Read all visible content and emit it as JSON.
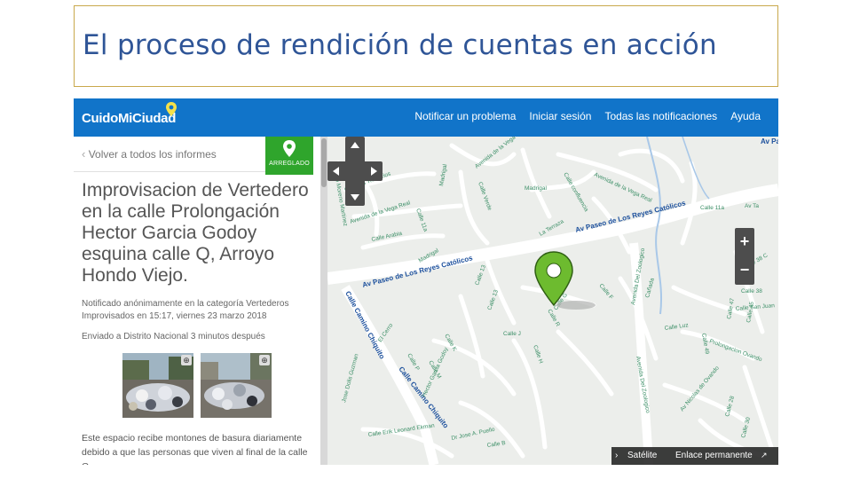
{
  "slide": {
    "title": "El proceso de rendición de cuentas en acción"
  },
  "app": {
    "logo": "CuidoMiCiudad",
    "nav": [
      "Notificar un problema",
      "Iniciar sesión",
      "Todas las notificaciones",
      "Ayuda"
    ]
  },
  "sidebar": {
    "back_link": "Volver a todos los informes",
    "status_badge": "ARREGLADO",
    "report_title": "Improvisacion de Vertedero en la calle Prolongación Hector Garcia Godoy esquina calle Q, Arroyo Hondo Viejo.",
    "meta_line1": "Notificado anónimamente en la categoría Vertederos Improvisados en 15:17, viernes 23 marzo 2018",
    "meta_line2": "Enviado a Distrito Nacional 3 minutos después",
    "description": "Este espacio recibe montones de basura diariamente debido a que las personas que viven al final de la calle Q"
  },
  "map": {
    "main_roads": [
      "Av Paseo de Los Reyes Católicos",
      "Av Paseo de Los Reyes Católicos",
      "Calle Camino Chiquito",
      "Calle Camino Chiquito"
    ],
    "streets": [
      "Calle los Trinitarios",
      "Avenida de la Vega Real",
      "Avenida de la Vega Real",
      "Avenida de la Vega Real",
      "Madrigal",
      "Madrigal",
      "Calle Arabia",
      "Calle Verde",
      "Calle confluencia",
      "La Terraza",
      "Madrigal",
      "Calle 11a",
      "Calle 13",
      "Calle J",
      "Calle K",
      "Calle P",
      "Calle M",
      "Hector Garcia Godoy",
      "Calle Erik Leonard Ekman",
      "Dr Jose A. Puello",
      "Calle B",
      "Calle Luz",
      "Calle 49",
      "Prolongacion Ovando",
      "Calle San Juan",
      "Calle 38",
      "Calle 47",
      "Calle 45",
      "Calle 38 C",
      "Av Nicolas de Ovando",
      "Calle F",
      "Calle G",
      "Calle H",
      "Calle R",
      "Cañada",
      "Avenida Del Zoologico",
      "Avenida Del Zoologico",
      "Jose Dolis Guzman",
      "El Cerro",
      "Calle 11a",
      "Calle 28",
      "Calle 30",
      "Av Ta",
      "Alfonso Moreno Martinez",
      "Calle 13"
    ],
    "labels_right": [
      "Av Pas"
    ],
    "controls": {
      "zoom_in": "+",
      "zoom_out": "−"
    },
    "footer": {
      "satellite": "Satélite",
      "permalink": "Enlace permanente"
    }
  },
  "colors": {
    "header": "#1174c9",
    "badge": "#2fa52c",
    "pin": "#6dbb2f",
    "title": "#2f5597"
  }
}
